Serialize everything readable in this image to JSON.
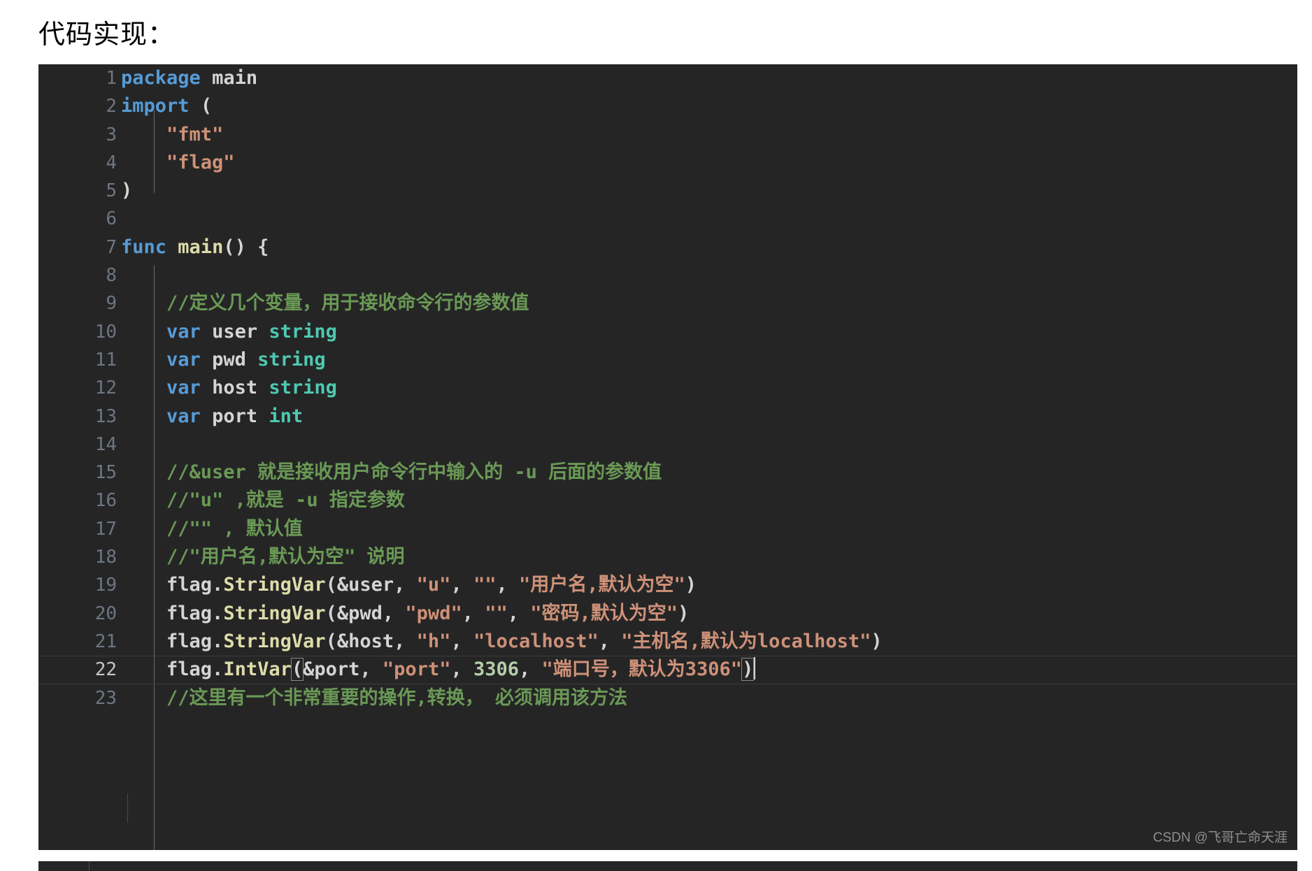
{
  "heading": "代码实现：",
  "watermark": "CSDN @飞哥亡命天涯",
  "editor": {
    "language": "Go",
    "theme_background": "#252526",
    "active_line": 22,
    "colors": {
      "background": "#252526",
      "foreground": "#d4d4d4",
      "keyword": "#569cd6",
      "function": "#dcdcaa",
      "type": "#4ec9b0",
      "string": "#ce9178",
      "number": "#b5cea8",
      "comment": "#6a9955",
      "line_number": "#6e7681",
      "line_number_active": "#c6c6c6"
    },
    "lines": [
      {
        "n": "1",
        "text": "package main"
      },
      {
        "n": "2",
        "text": "import ("
      },
      {
        "n": "3",
        "text": "    \"fmt\""
      },
      {
        "n": "4",
        "text": "    \"flag\""
      },
      {
        "n": "5",
        "text": ")"
      },
      {
        "n": "6",
        "text": ""
      },
      {
        "n": "7",
        "text": "func main() {"
      },
      {
        "n": "8",
        "text": ""
      },
      {
        "n": "9",
        "text": "    //定义几个变量，用于接收命令行的参数值"
      },
      {
        "n": "10",
        "text": "    var user string"
      },
      {
        "n": "11",
        "text": "    var pwd string"
      },
      {
        "n": "12",
        "text": "    var host string"
      },
      {
        "n": "13",
        "text": "    var port int"
      },
      {
        "n": "14",
        "text": ""
      },
      {
        "n": "15",
        "text": "    //&user 就是接收用户命令行中输入的 -u 后面的参数值"
      },
      {
        "n": "16",
        "text": "    //\"u\" ,就是 -u 指定参数"
      },
      {
        "n": "17",
        "text": "    //\"\" , 默认值"
      },
      {
        "n": "18",
        "text": "    //\"用户名,默认为空\" 说明"
      },
      {
        "n": "19",
        "text": "    flag.StringVar(&user, \"u\", \"\", \"用户名,默认为空\")"
      },
      {
        "n": "20",
        "text": "    flag.StringVar(&pwd, \"pwd\", \"\", \"密码,默认为空\")"
      },
      {
        "n": "21",
        "text": "    flag.StringVar(&host, \"h\", \"localhost\", \"主机名,默认为localhost\")"
      },
      {
        "n": "22",
        "text": "    flag.IntVar(&port, \"port\", 3306, \"端口号，默认为3306\")"
      },
      {
        "n": "23",
        "text": "    //这里有一个非常重要的操作,转换， 必须调用该方法"
      }
    ]
  }
}
